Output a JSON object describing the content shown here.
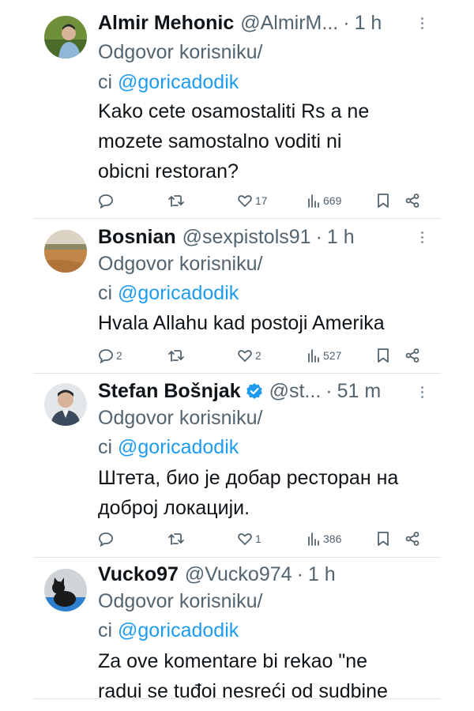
{
  "tweets": [
    {
      "name": "Almir Mehonic",
      "handle": "@AlmirM...",
      "time": "1 h",
      "reply_label": "Odgovor korisniku/",
      "reply_prefix": "ci",
      "mention": "@goricadodik",
      "body": [
        "Kako cete osamostaliti Rs a ne",
        "mozete samostalno voditi ni",
        "obicni restoran?"
      ],
      "replies": "",
      "retweets": "",
      "likes": "17",
      "views": "669",
      "verified": false,
      "avatar_icon": "man-portrait-avatar"
    },
    {
      "name": "Bosnian",
      "handle": "@sexpistols91",
      "time": "1 h",
      "reply_label": "Odgovor korisniku/",
      "reply_prefix": "ci",
      "mention": "@goricadodik",
      "body": [
        "Hvala Allahu kad postoji Amerika"
      ],
      "replies": "2",
      "retweets": "",
      "likes": "2",
      "views": "527",
      "verified": false,
      "avatar_icon": "landscape-avatar"
    },
    {
      "name": "Stefan Bošnjak",
      "handle": "@st...",
      "time": "51 m",
      "reply_label": "Odgovor korisniku/",
      "reply_prefix": "ci",
      "mention": "@goricadodik",
      "body": [
        "Штета, био је добар ресторан на",
        "доброј локацији."
      ],
      "replies": "",
      "retweets": "",
      "likes": "1",
      "views": "386",
      "verified": true,
      "avatar_icon": "man-suit-avatar"
    },
    {
      "name": "Vucko97",
      "handle": "@Vucko974",
      "time": "1 h",
      "reply_label": "Odgovor korisniku/",
      "reply_prefix": "ci",
      "mention": "@goricadodik",
      "body": [
        "Za ove komentare bi rekao \"ne",
        "radui se tuđoi nesreći od sudbine"
      ],
      "verified": false,
      "avatar_icon": "cat-avatar"
    }
  ],
  "time_separator": "·",
  "colors": {
    "text": "#0f1419",
    "secondary": "#536471",
    "link": "#1d9bf0",
    "divider": "#e1e6ea"
  }
}
